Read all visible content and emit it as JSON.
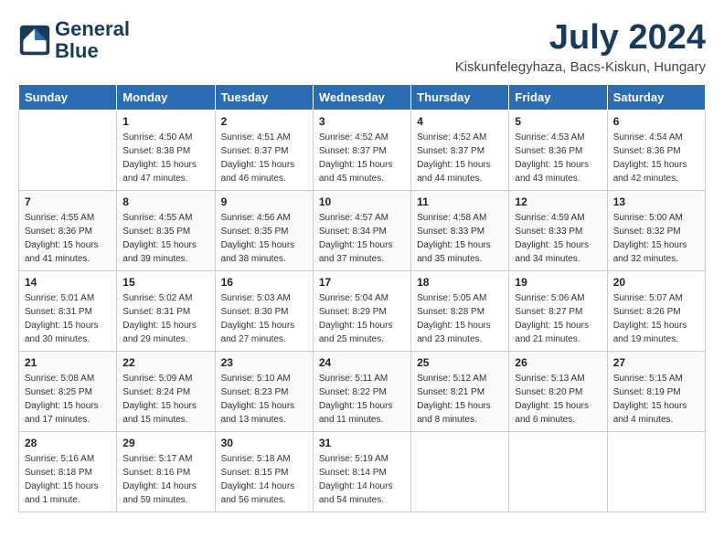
{
  "header": {
    "logo_line1": "General",
    "logo_line2": "Blue",
    "month": "July 2024",
    "location": "Kiskunfelegyhaza, Bacs-Kiskun, Hungary"
  },
  "days_of_week": [
    "Sunday",
    "Monday",
    "Tuesday",
    "Wednesday",
    "Thursday",
    "Friday",
    "Saturday"
  ],
  "weeks": [
    [
      {
        "day": "",
        "sunrise": "",
        "sunset": "",
        "daylight": ""
      },
      {
        "day": "1",
        "sunrise": "Sunrise: 4:50 AM",
        "sunset": "Sunset: 8:38 PM",
        "daylight": "Daylight: 15 hours and 47 minutes."
      },
      {
        "day": "2",
        "sunrise": "Sunrise: 4:51 AM",
        "sunset": "Sunset: 8:37 PM",
        "daylight": "Daylight: 15 hours and 46 minutes."
      },
      {
        "day": "3",
        "sunrise": "Sunrise: 4:52 AM",
        "sunset": "Sunset: 8:37 PM",
        "daylight": "Daylight: 15 hours and 45 minutes."
      },
      {
        "day": "4",
        "sunrise": "Sunrise: 4:52 AM",
        "sunset": "Sunset: 8:37 PM",
        "daylight": "Daylight: 15 hours and 44 minutes."
      },
      {
        "day": "5",
        "sunrise": "Sunrise: 4:53 AM",
        "sunset": "Sunset: 8:36 PM",
        "daylight": "Daylight: 15 hours and 43 minutes."
      },
      {
        "day": "6",
        "sunrise": "Sunrise: 4:54 AM",
        "sunset": "Sunset: 8:36 PM",
        "daylight": "Daylight: 15 hours and 42 minutes."
      }
    ],
    [
      {
        "day": "7",
        "sunrise": "Sunrise: 4:55 AM",
        "sunset": "Sunset: 8:36 PM",
        "daylight": "Daylight: 15 hours and 41 minutes."
      },
      {
        "day": "8",
        "sunrise": "Sunrise: 4:55 AM",
        "sunset": "Sunset: 8:35 PM",
        "daylight": "Daylight: 15 hours and 39 minutes."
      },
      {
        "day": "9",
        "sunrise": "Sunrise: 4:56 AM",
        "sunset": "Sunset: 8:35 PM",
        "daylight": "Daylight: 15 hours and 38 minutes."
      },
      {
        "day": "10",
        "sunrise": "Sunrise: 4:57 AM",
        "sunset": "Sunset: 8:34 PM",
        "daylight": "Daylight: 15 hours and 37 minutes."
      },
      {
        "day": "11",
        "sunrise": "Sunrise: 4:58 AM",
        "sunset": "Sunset: 8:33 PM",
        "daylight": "Daylight: 15 hours and 35 minutes."
      },
      {
        "day": "12",
        "sunrise": "Sunrise: 4:59 AM",
        "sunset": "Sunset: 8:33 PM",
        "daylight": "Daylight: 15 hours and 34 minutes."
      },
      {
        "day": "13",
        "sunrise": "Sunrise: 5:00 AM",
        "sunset": "Sunset: 8:32 PM",
        "daylight": "Daylight: 15 hours and 32 minutes."
      }
    ],
    [
      {
        "day": "14",
        "sunrise": "Sunrise: 5:01 AM",
        "sunset": "Sunset: 8:31 PM",
        "daylight": "Daylight: 15 hours and 30 minutes."
      },
      {
        "day": "15",
        "sunrise": "Sunrise: 5:02 AM",
        "sunset": "Sunset: 8:31 PM",
        "daylight": "Daylight: 15 hours and 29 minutes."
      },
      {
        "day": "16",
        "sunrise": "Sunrise: 5:03 AM",
        "sunset": "Sunset: 8:30 PM",
        "daylight": "Daylight: 15 hours and 27 minutes."
      },
      {
        "day": "17",
        "sunrise": "Sunrise: 5:04 AM",
        "sunset": "Sunset: 8:29 PM",
        "daylight": "Daylight: 15 hours and 25 minutes."
      },
      {
        "day": "18",
        "sunrise": "Sunrise: 5:05 AM",
        "sunset": "Sunset: 8:28 PM",
        "daylight": "Daylight: 15 hours and 23 minutes."
      },
      {
        "day": "19",
        "sunrise": "Sunrise: 5:06 AM",
        "sunset": "Sunset: 8:27 PM",
        "daylight": "Daylight: 15 hours and 21 minutes."
      },
      {
        "day": "20",
        "sunrise": "Sunrise: 5:07 AM",
        "sunset": "Sunset: 8:26 PM",
        "daylight": "Daylight: 15 hours and 19 minutes."
      }
    ],
    [
      {
        "day": "21",
        "sunrise": "Sunrise: 5:08 AM",
        "sunset": "Sunset: 8:25 PM",
        "daylight": "Daylight: 15 hours and 17 minutes."
      },
      {
        "day": "22",
        "sunrise": "Sunrise: 5:09 AM",
        "sunset": "Sunset: 8:24 PM",
        "daylight": "Daylight: 15 hours and 15 minutes."
      },
      {
        "day": "23",
        "sunrise": "Sunrise: 5:10 AM",
        "sunset": "Sunset: 8:23 PM",
        "daylight": "Daylight: 15 hours and 13 minutes."
      },
      {
        "day": "24",
        "sunrise": "Sunrise: 5:11 AM",
        "sunset": "Sunset: 8:22 PM",
        "daylight": "Daylight: 15 hours and 11 minutes."
      },
      {
        "day": "25",
        "sunrise": "Sunrise: 5:12 AM",
        "sunset": "Sunset: 8:21 PM",
        "daylight": "Daylight: 15 hours and 8 minutes."
      },
      {
        "day": "26",
        "sunrise": "Sunrise: 5:13 AM",
        "sunset": "Sunset: 8:20 PM",
        "daylight": "Daylight: 15 hours and 6 minutes."
      },
      {
        "day": "27",
        "sunrise": "Sunrise: 5:15 AM",
        "sunset": "Sunset: 8:19 PM",
        "daylight": "Daylight: 15 hours and 4 minutes."
      }
    ],
    [
      {
        "day": "28",
        "sunrise": "Sunrise: 5:16 AM",
        "sunset": "Sunset: 8:18 PM",
        "daylight": "Daylight: 15 hours and 1 minute."
      },
      {
        "day": "29",
        "sunrise": "Sunrise: 5:17 AM",
        "sunset": "Sunset: 8:16 PM",
        "daylight": "Daylight: 14 hours and 59 minutes."
      },
      {
        "day": "30",
        "sunrise": "Sunrise: 5:18 AM",
        "sunset": "Sunset: 8:15 PM",
        "daylight": "Daylight: 14 hours and 56 minutes."
      },
      {
        "day": "31",
        "sunrise": "Sunrise: 5:19 AM",
        "sunset": "Sunset: 8:14 PM",
        "daylight": "Daylight: 14 hours and 54 minutes."
      },
      {
        "day": "",
        "sunrise": "",
        "sunset": "",
        "daylight": ""
      },
      {
        "day": "",
        "sunrise": "",
        "sunset": "",
        "daylight": ""
      },
      {
        "day": "",
        "sunrise": "",
        "sunset": "",
        "daylight": ""
      }
    ]
  ]
}
